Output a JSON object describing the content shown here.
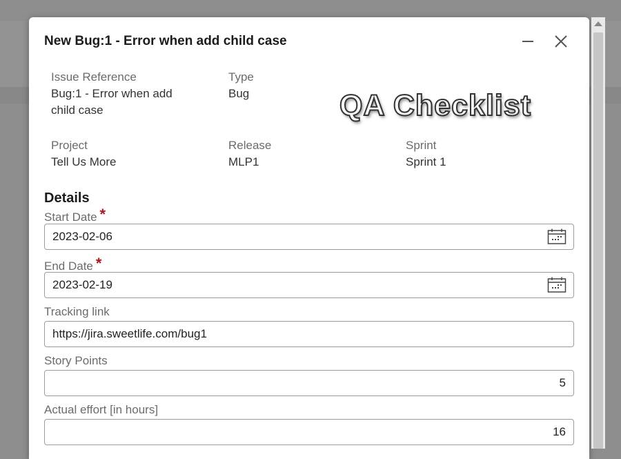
{
  "dialog": {
    "title": "New Bug:1 - Error when add child case",
    "minimize_icon": "minimize-icon",
    "close_icon": "close-icon"
  },
  "watermark": "QA Checklist",
  "meta": {
    "issue_reference": {
      "label": "Issue Reference",
      "value_line1": "Bug:1 - Error when add",
      "value_line2": "child case"
    },
    "type": {
      "label": "Type",
      "value": "Bug"
    },
    "project": {
      "label": "Project",
      "value": "Tell Us More"
    },
    "release": {
      "label": "Release",
      "value": "MLP1"
    },
    "sprint": {
      "label": "Sprint",
      "value": "Sprint 1"
    }
  },
  "details": {
    "title": "Details",
    "required_marker": "*",
    "start_date": {
      "label": "Start Date",
      "value": "2023-02-06",
      "icon": "calendar-icon"
    },
    "end_date": {
      "label": "End Date",
      "value": "2023-02-19",
      "icon": "calendar-icon"
    },
    "tracking_link": {
      "label": "Tracking link",
      "value": "https://jira.sweetlife.com/bug1"
    },
    "story_points": {
      "label": "Story Points",
      "value": "5"
    },
    "actual_effort": {
      "label": "Actual effort [in hours]",
      "value": "16"
    }
  },
  "colors": {
    "backdrop": "#8e8e8e",
    "required": "#b3141b",
    "label": "#6b6b6b"
  }
}
